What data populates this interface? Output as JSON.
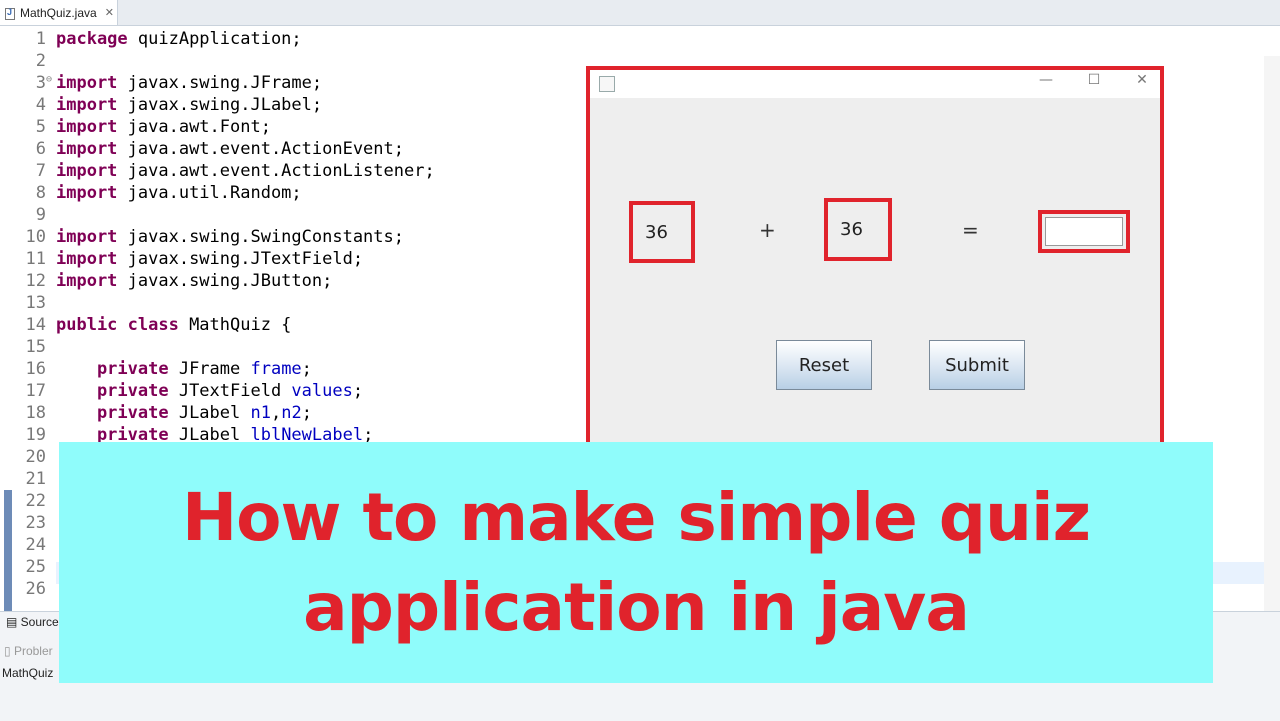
{
  "editor": {
    "tab_label": "MathQuiz.java",
    "tab_close": "✕",
    "lines": [
      {
        "n": "1",
        "kw": "package",
        "rest": " quizApplication;"
      },
      {
        "n": "2",
        "kw": "",
        "rest": ""
      },
      {
        "n": "3",
        "kw": "import",
        "rest": " javax.swing.JFrame;",
        "fold": "⊖"
      },
      {
        "n": "4",
        "kw": "import",
        "rest": " javax.swing.JLabel;"
      },
      {
        "n": "5",
        "kw": "import",
        "rest": " java.awt.Font;"
      },
      {
        "n": "6",
        "kw": "import",
        "rest": " java.awt.event.ActionEvent;"
      },
      {
        "n": "7",
        "kw": "import",
        "rest": " java.awt.event.ActionListener;"
      },
      {
        "n": "8",
        "kw": "import",
        "rest": " java.util.Random;"
      },
      {
        "n": "9",
        "kw": "",
        "rest": ""
      },
      {
        "n": "10",
        "kw": "import",
        "rest": " javax.swing.SwingConstants;"
      },
      {
        "n": "11",
        "kw": "import",
        "rest": " javax.swing.JTextField;"
      },
      {
        "n": "12",
        "kw": "import",
        "rest": " javax.swing.JButton;"
      },
      {
        "n": "13",
        "kw": "",
        "rest": ""
      },
      {
        "n": "14",
        "kw": "public class",
        "rest": " MathQuiz {"
      },
      {
        "n": "15",
        "kw": "",
        "rest": ""
      },
      {
        "n": "16",
        "kw": "    private",
        "rest": " JFrame ",
        "field": "frame",
        "tail": ";"
      },
      {
        "n": "17",
        "kw": "    private",
        "rest": " JTextField ",
        "field": "values",
        "tail": ";"
      },
      {
        "n": "18",
        "kw": "    private",
        "rest": " JLabel ",
        "field": "n1",
        "tail": ",",
        "field2": "n2",
        "tail2": ";"
      },
      {
        "n": "19",
        "kw": "    private",
        "rest": " JLabel ",
        "field": "lblNewLabel",
        "tail": ";"
      },
      {
        "n": "20",
        "kw": "",
        "rest": ""
      },
      {
        "n": "21",
        "kw": "",
        "rest": ""
      },
      {
        "n": "22",
        "kw": "",
        "rest": ""
      },
      {
        "n": "23",
        "kw": "",
        "rest": ""
      },
      {
        "n": "24",
        "kw": "",
        "rest": ""
      },
      {
        "n": "25",
        "kw": "",
        "rest": ""
      },
      {
        "n": "26",
        "kw": "",
        "rest": ""
      }
    ]
  },
  "bottom_panel": {
    "source_tab": "Source",
    "problems_tab": "Probler",
    "status_text": "MathQuiz"
  },
  "quiz_window": {
    "minimize": "—",
    "maximize": "☐",
    "close": "✕",
    "num1": "36",
    "operator": "+",
    "num2": "36",
    "equals": "=",
    "answer_value": "",
    "reset_label": "Reset",
    "submit_label": "Submit"
  },
  "banner": {
    "line1": "How to make simple quiz",
    "line2": "application in java"
  },
  "colors": {
    "highlight_red": "#e0232c",
    "banner_bg": "#8ffcfb",
    "keyword": "#7f0055",
    "field": "#0000c0"
  }
}
